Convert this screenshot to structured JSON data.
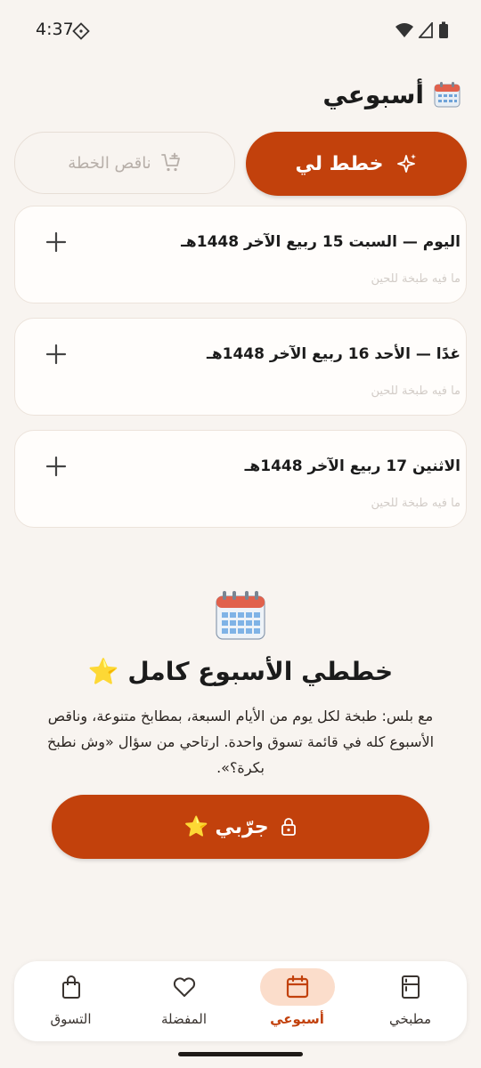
{
  "status": {
    "time": "4:37"
  },
  "header": {
    "title": "أسبوعي",
    "icon": "calendar-icon"
  },
  "actions": {
    "plan_label": "خطط لي",
    "plan_icon": "sparkle-icon",
    "missing_label": "ناقص الخطة",
    "missing_icon": "cart-add-icon"
  },
  "days": [
    {
      "title": "اليوم — السبت 15 ربيع الآخر 1448هـ",
      "subtitle": "ما فيه طبخة للحين"
    },
    {
      "title": "غدًا — الأحد 16 ربيع الآخر 1448هـ",
      "subtitle": "ما فيه طبخة للحين"
    },
    {
      "title": "الاثنين 17 ربيع الآخر 1448هـ",
      "subtitle": "ما فيه طبخة للحين"
    }
  ],
  "promo": {
    "icon": "calendar-icon",
    "title": "خططي الأسبوع كامل ⭐",
    "body": "مع بلس: طبخة لكل يوم من الأيام السبعة، بمطابخ متنوعة، وناقص الأسبوع كله في قائمة تسوق واحدة. ارتاحي من سؤال «وش نطبخ بكرة؟».",
    "cta_label": "جرّبي ⭐",
    "cta_icon": "lock-icon"
  },
  "nav": {
    "items": [
      {
        "label": "التسوق",
        "icon": "shopping-bag-icon"
      },
      {
        "label": "المفضلة",
        "icon": "heart-icon"
      },
      {
        "label": "أسبوعي",
        "icon": "calendar-icon",
        "active": true
      },
      {
        "label": "مطبخي",
        "icon": "fridge-icon"
      }
    ]
  },
  "colors": {
    "accent": "#C2410C",
    "background": "#F8F4F0",
    "active_pill": "#FBDDCB"
  }
}
